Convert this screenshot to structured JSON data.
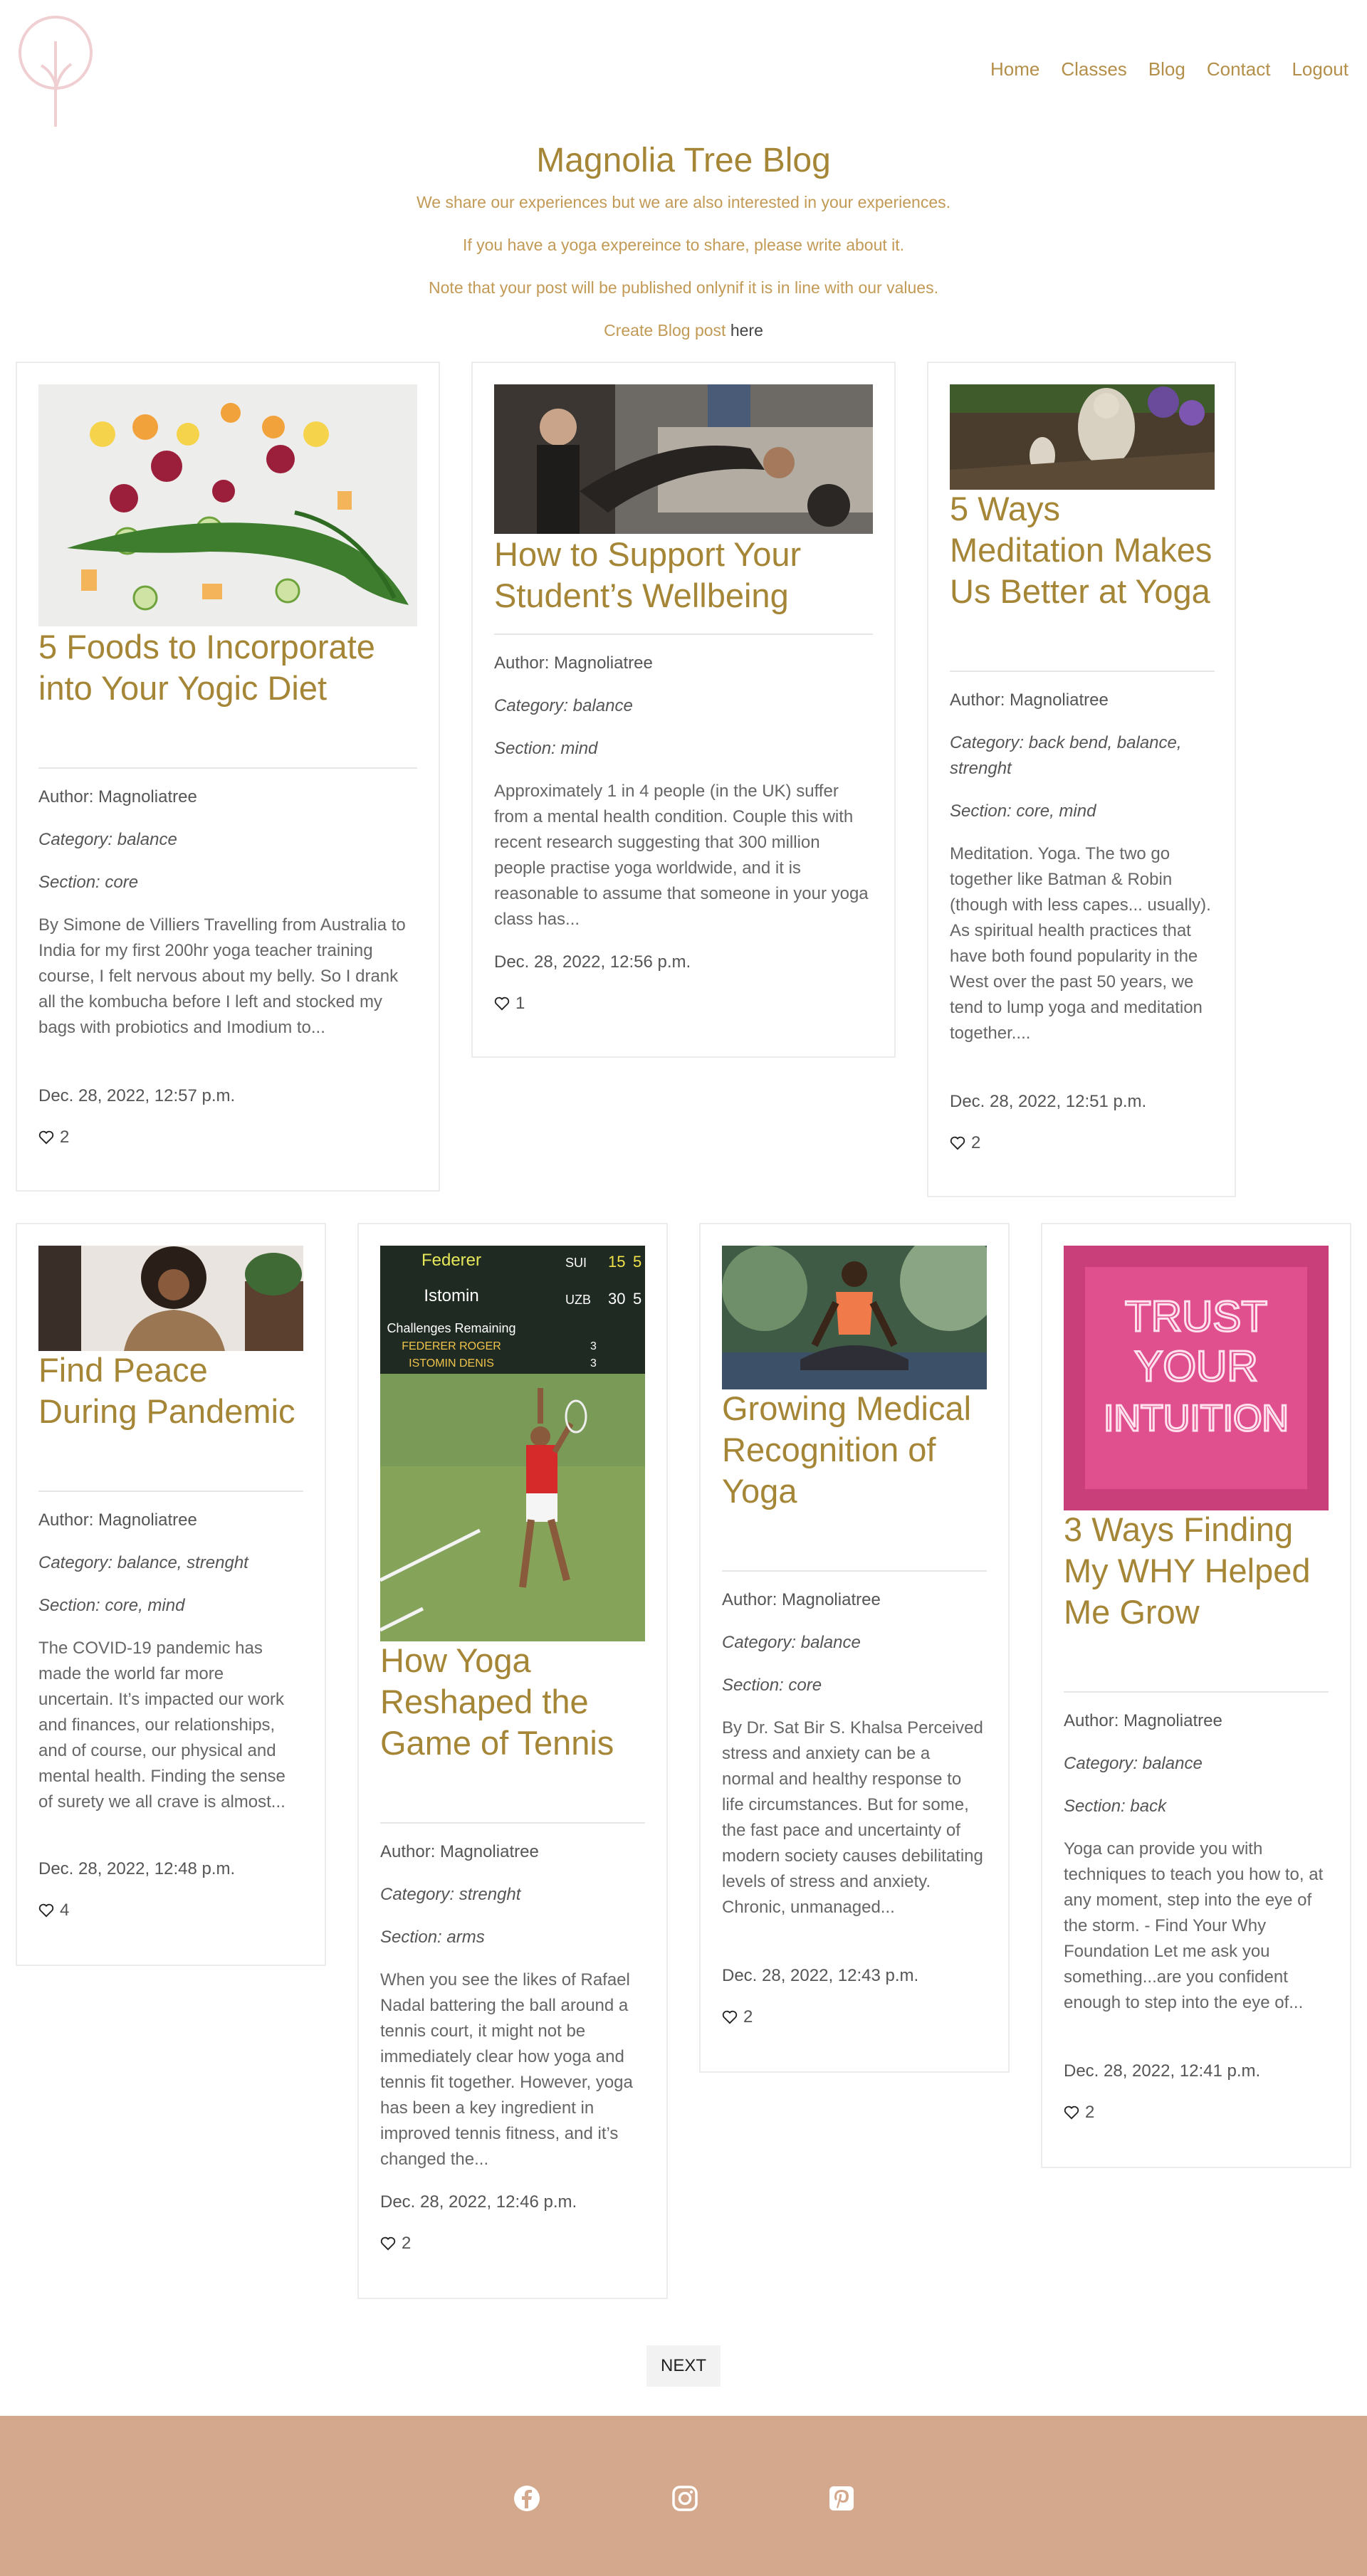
{
  "nav": {
    "home": "Home",
    "classes": "Classes",
    "blog": "Blog",
    "contact": "Contact",
    "logout": "Logout"
  },
  "hero": {
    "title": "Magnolia Tree Blog",
    "line1": "We share our experiences but we are also interested in your experiences.",
    "line2": "If you have a yoga expereince to share, please write about it.",
    "line3": "Note that your post will be published onlynif it is in line with our values.",
    "create_prefix": "Create Blog post",
    "create_link": "here"
  },
  "posts": [
    {
      "title": "5 Foods to Incorporate into Your Yogic Diet",
      "author": "Author: Magnoliatree",
      "category": "Category: balance",
      "section": "Section: core",
      "excerpt": "By Simone de Villiers Travelling from Australia to India for my first 200hr yoga teacher training course, I felt nervous about my belly. So I drank all the kombucha before I left and stocked my bags with probiotics and Imodium to...",
      "date": "Dec. 28, 2022, 12:57 p.m.",
      "likes": "2"
    },
    {
      "title": "How to Support Your Student’s Wellbeing",
      "author": "Author: Magnoliatree",
      "category": "Category: balance",
      "section": "Section: mind",
      "excerpt": "Approximately 1 in 4 people (in the UK) suffer from a mental health condition. Couple this with recent research suggesting that 300 million people practise yoga worldwide, and it is reasonable to assume that someone in your yoga class has...",
      "date": "Dec. 28, 2022, 12:56 p.m.",
      "likes": "1"
    },
    {
      "title": "5 Ways Meditation Makes Us Better at Yoga",
      "author": "Author: Magnoliatree",
      "category": "Category: back bend, balance, strenght",
      "section": "Section: core, mind",
      "excerpt": "Meditation. Yoga. The two go together like Batman & Robin (though with less capes... usually). As spiritual health practices that have both found popularity in the West over the past 50 years, we tend to lump yoga and meditation together....",
      "date": "Dec. 28, 2022, 12:51 p.m.",
      "likes": "2"
    },
    {
      "title": "Find Peace During Pandemic",
      "author": "Author: Magnoliatree",
      "category": "Category: balance, strenght",
      "section": "Section: core, mind",
      "excerpt": "The COVID-19 pandemic has made the world far more uncertain. It’s impacted our work and finances, our relationships, and of course, our physical and mental health. Finding the sense of surety we all crave is almost...",
      "date": "Dec. 28, 2022, 12:48 p.m.",
      "likes": "4"
    },
    {
      "title": "How Yoga Reshaped the Game of Tennis",
      "author": "Author: Magnoliatree",
      "category": "Category: strenght",
      "section": "Section: arms",
      "excerpt": "When you see the likes of Rafael Nadal battering the ball around a tennis court, it might not be immediately clear how yoga and tennis fit together. However, yoga has been a key ingredient in improved tennis fitness, and it’s changed the...",
      "date": "Dec. 28, 2022, 12:46 p.m.",
      "likes": "2"
    },
    {
      "title": "Growing Medical Recognition of Yoga",
      "author": "Author: Magnoliatree",
      "category": "Category: balance",
      "section": "Section: core",
      "excerpt": "By Dr. Sat Bir S. Khalsa Perceived stress and anxiety can be a normal and healthy response to life circumstances. But for some, the fast pace and uncertainty of modern society causes debilitating levels of stress and anxiety. Chronic, unmanaged...",
      "date": "Dec. 28, 2022, 12:43 p.m.",
      "likes": "2"
    },
    {
      "title": "3 Ways Finding My WHY Helped Me Grow",
      "author": "Author: Magnoliatree",
      "category": "Category: balance",
      "section": "Section: back",
      "excerpt": "Yoga can provide you with techniques to teach you how to, at any moment, step into the eye of the storm. - Find Your Why Foundation Let me ask you something...are you confident enough to step into the eye of...",
      "date": "Dec. 28, 2022, 12:41 p.m.",
      "likes": "2"
    }
  ],
  "scoreboard": {
    "p1": "Federer",
    "p2": "Istomin",
    "c1": "SUI",
    "c2": "UZB",
    "s1": "15",
    "s2": "30",
    "s1b": "5",
    "s2b": "5",
    "chal": "Challenges Remaining",
    "r1": "FEDERER ROGER",
    "r2": "ISTOMIN DENIS",
    "n1": "3",
    "n2": "3"
  },
  "neon": {
    "l1": "TRUST",
    "l2": "YOUR",
    "l3": "INTUITION"
  },
  "pagination": {
    "next": "NEXT"
  },
  "footer": {
    "icons": [
      "facebook-icon",
      "instagram-icon",
      "pinterest-icon"
    ]
  },
  "colors": {
    "accent": "#a58536",
    "footer": "#d4a88c"
  }
}
